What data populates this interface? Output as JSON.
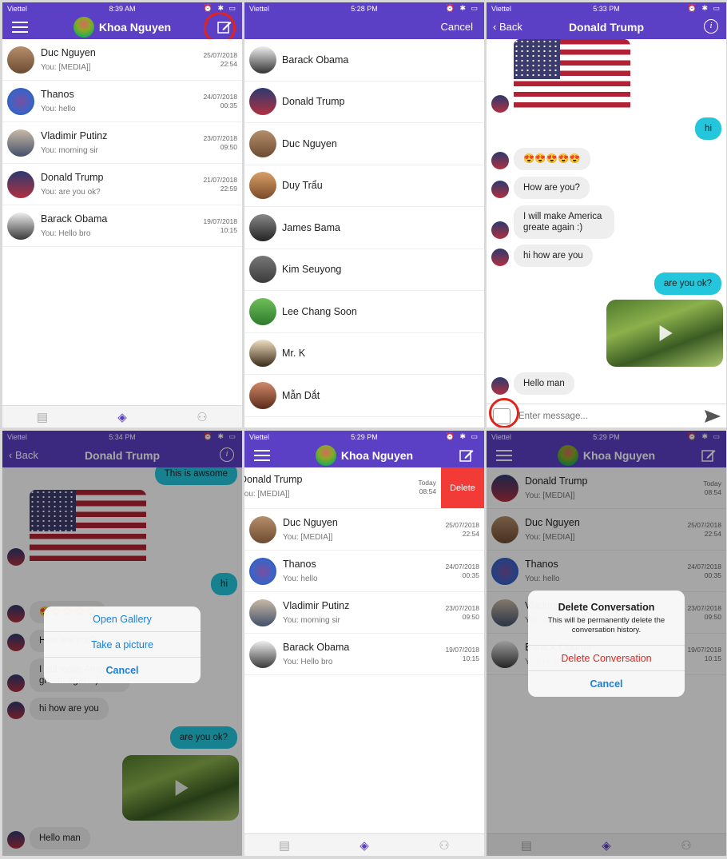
{
  "status": {
    "carrier": "Viettel",
    "icons": "⏰ ✱ ▭",
    "times": {
      "p1": "8:39 AM",
      "p2": "5:28 PM",
      "p3": "5:33 PM",
      "p4": "5:34 PM",
      "p5": "5:29 PM",
      "p6": "5:29 PM"
    }
  },
  "header": {
    "user_name": "Khoa Nguyen",
    "cancel_label": "Cancel",
    "back_label": "Back",
    "chat_title": "Donald Trump",
    "info_glyph": "i"
  },
  "conversations": [
    {
      "name": "Duc Nguyen",
      "last": "You: [MEDIA]]",
      "date": "25/07/2018",
      "time": "22:54"
    },
    {
      "name": "Thanos",
      "last": "You: hello",
      "date": "24/07/2018",
      "time": "00:35"
    },
    {
      "name": "Vladimir Putinz",
      "last": "You: morning sir",
      "date": "23/07/2018",
      "time": "09:50"
    },
    {
      "name": "Donald Trump",
      "last": "You: are you ok?",
      "date": "21/07/2018",
      "time": "22:59"
    },
    {
      "name": "Barack Obama",
      "last": "You: Hello bro",
      "date": "19/07/2018",
      "time": "10:15"
    }
  ],
  "contacts": [
    "Barack Obama",
    "Donald Trump",
    "Duc Nguyen",
    "Duy Trẩu",
    "James Bama",
    "Kim Seuyong",
    "Lee Chang Soon",
    "Mr. K",
    "Mẫn Dắt"
  ],
  "chat": {
    "hi": "hi",
    "emoji": "😍😍😍😍😍",
    "how": "How are you?",
    "america": "I will make America greate again :)",
    "hi_how": "hi how are you",
    "are_you_ok": "are you ok?",
    "hello_man": "Hello man",
    "awesome": "This is awsome",
    "input_placeholder": "Enter message..."
  },
  "picker": {
    "open_gallery": "Open Gallery",
    "take_picture": "Take a picture",
    "cancel": "Cancel"
  },
  "swipe_list": {
    "top": {
      "name": "Donald Trump",
      "last": "You: [MEDIA]]",
      "date": "Today",
      "time": "08:54"
    },
    "delete_label": "Delete",
    "rows": [
      {
        "name": "Duc Nguyen",
        "last": "You: [MEDIA]]",
        "date": "25/07/2018",
        "time": "22:54"
      },
      {
        "name": "Thanos",
        "last": "You: hello",
        "date": "24/07/2018",
        "time": "00:35"
      },
      {
        "name": "Vladimir Putinz",
        "last": "You: morning sir",
        "date": "23/07/2018",
        "time": "09:50"
      },
      {
        "name": "Barack Obama",
        "last": "You: Hello bro",
        "date": "19/07/2018",
        "time": "10:15"
      }
    ]
  },
  "alert": {
    "title": "Delete Conversation",
    "message": "This will be permanently delete the conversation history.",
    "delete": "Delete Conversation",
    "cancel": "Cancel"
  },
  "colors": {
    "brand": "#5b3fc4",
    "outgoing": "#24c6dc",
    "destructive": "#e2231a",
    "link": "#1a7fd6"
  },
  "icons": {
    "menu": "hamburger-icon",
    "compose": "edit-icon",
    "info": "info-icon",
    "media": "gallery-icon",
    "send": "send-icon",
    "tabs": [
      "contacts-tab-icon",
      "chat-tab-icon",
      "groups-tab-icon"
    ]
  }
}
